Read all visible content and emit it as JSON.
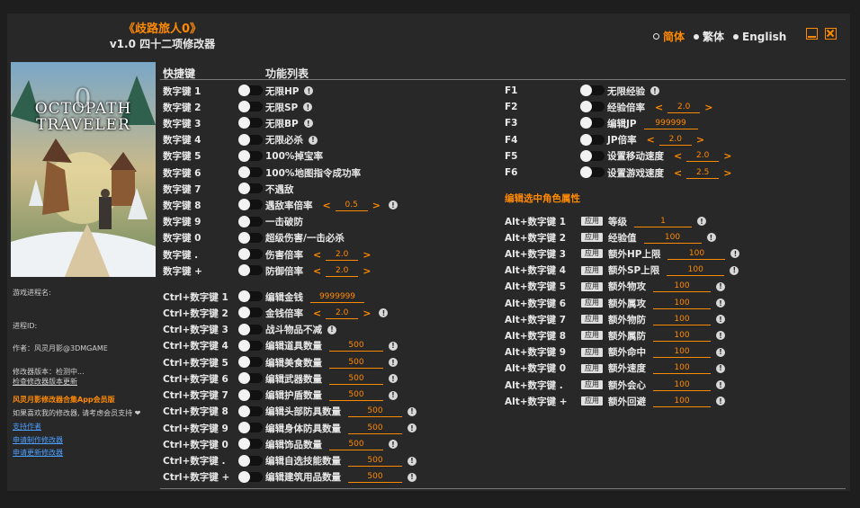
{
  "header": {
    "title": "《歧路旅人0》",
    "subtitle": "v1.0 四十二项修改器"
  },
  "languages": [
    {
      "label": "简体",
      "active": true
    },
    {
      "label": "繁体",
      "active": false
    },
    {
      "label": "English",
      "active": false
    }
  ],
  "cover": {
    "line1": "OCTOPATH",
    "line2": "TRAVELER",
    "logo_mark": "0"
  },
  "sidebar": {
    "process_label": "游戏进程名:",
    "pid_label": "进程ID:",
    "author": "作者：风灵月影@3DMGAME",
    "version_status": "修改器版本：检测中...",
    "check_update": "检查修改器版本更新",
    "promo": "风灵月影修改器合集App会员版",
    "support_note": "如果喜欢我的修改器, 请考虑会员支持 ❤",
    "links": [
      "支持作者",
      "申请制作修改器",
      "申请更新修改器"
    ]
  },
  "columns": {
    "hotkey": "快捷键",
    "function_list": "功能列表"
  },
  "apply_label": "应用",
  "left_rows": [
    {
      "key": "数字键 1",
      "label": "无限HP",
      "info": true
    },
    {
      "key": "数字键 2",
      "label": "无限SP",
      "info": true
    },
    {
      "key": "数字键 3",
      "label": "无限BP",
      "info": true
    },
    {
      "key": "数字键 4",
      "label": "无限必杀",
      "info": true
    },
    {
      "key": "数字键 5",
      "label": "100%掉宝率"
    },
    {
      "key": "数字键 6",
      "label": "100%地图指令成功率"
    },
    {
      "key": "数字键 7",
      "label": "不遇敌"
    },
    {
      "key": "数字键 8",
      "label": "遇敌率倍率",
      "value": "0.5",
      "stepper": true,
      "info": true
    },
    {
      "key": "数字键 9",
      "label": "一击破防"
    },
    {
      "key": "数字键 0",
      "label": "超级伤害/一击必杀"
    },
    {
      "key": "数字键 .",
      "label": "伤害倍率",
      "value": "2.0",
      "stepper": true
    },
    {
      "key": "数字键 +",
      "label": "防御倍率",
      "value": "2.0",
      "stepper": true
    },
    {
      "key": "Ctrl+数字键 1",
      "label": "编辑金钱",
      "value": "9999999"
    },
    {
      "key": "Ctrl+数字键 2",
      "label": "金钱倍率",
      "value": "2.0",
      "stepper": true,
      "info": true
    },
    {
      "key": "Ctrl+数字键 3",
      "label": "战斗物品不减",
      "info": true
    },
    {
      "key": "Ctrl+数字键 4",
      "label": "编辑道具数量",
      "value": "500",
      "info": true
    },
    {
      "key": "Ctrl+数字键 5",
      "label": "编辑美食数量",
      "value": "500",
      "info": true
    },
    {
      "key": "Ctrl+数字键 6",
      "label": "编辑武器数量",
      "value": "500",
      "info": true
    },
    {
      "key": "Ctrl+数字键 7",
      "label": "编辑护盾数量",
      "value": "500",
      "info": true
    },
    {
      "key": "Ctrl+数字键 8",
      "label": "编辑头部防具数量",
      "value": "500",
      "info": true
    },
    {
      "key": "Ctrl+数字键 9",
      "label": "编辑身体防具数量",
      "value": "500",
      "info": true
    },
    {
      "key": "Ctrl+数字键 0",
      "label": "编辑饰品数量",
      "value": "500",
      "info": true
    },
    {
      "key": "Ctrl+数字键 .",
      "label": "编辑自选技能数量",
      "value": "500",
      "info": true
    },
    {
      "key": "Ctrl+数字键 +",
      "label": "编辑建筑用品数量",
      "value": "500",
      "info": true
    }
  ],
  "right_rows": [
    {
      "key": "F1",
      "label": "无限经验",
      "info": true
    },
    {
      "key": "F2",
      "label": "经验倍率",
      "value": "2.0",
      "stepper": true
    },
    {
      "key": "F3",
      "label": "编辑JP",
      "value": "999999"
    },
    {
      "key": "F4",
      "label": "JP倍率",
      "value": "2.0",
      "stepper": true
    },
    {
      "key": "F5",
      "label": "设置移动速度",
      "value": "2.0",
      "stepper": true
    },
    {
      "key": "F6",
      "label": "设置游戏速度",
      "value": "2.5",
      "stepper": true
    }
  ],
  "attr_section_title": "编辑选中角色属性",
  "attr_rows": [
    {
      "key": "Alt+数字键 1",
      "label": "等级",
      "value": "1",
      "info": true
    },
    {
      "key": "Alt+数字键 2",
      "label": "经验值",
      "value": "100",
      "info": true
    },
    {
      "key": "Alt+数字键 3",
      "label": "额外HP上限",
      "value": "100",
      "info": true
    },
    {
      "key": "Alt+数字键 4",
      "label": "额外SP上限",
      "value": "100",
      "info": true
    },
    {
      "key": "Alt+数字键 5",
      "label": "额外物攻",
      "value": "100",
      "info": true
    },
    {
      "key": "Alt+数字键 6",
      "label": "额外属攻",
      "value": "100",
      "info": true
    },
    {
      "key": "Alt+数字键 7",
      "label": "额外物防",
      "value": "100",
      "info": true
    },
    {
      "key": "Alt+数字键 8",
      "label": "额外属防",
      "value": "100",
      "info": true
    },
    {
      "key": "Alt+数字键 9",
      "label": "额外命中",
      "value": "100",
      "info": true
    },
    {
      "key": "Alt+数字键 0",
      "label": "额外速度",
      "value": "100",
      "info": true
    },
    {
      "key": "Alt+数字键 .",
      "label": "额外会心",
      "value": "100",
      "info": true
    },
    {
      "key": "Alt+数字键 +",
      "label": "额外回避",
      "value": "100",
      "info": true
    }
  ],
  "colors": {
    "accent": "#ff8a00",
    "link": "#4a9fff",
    "background": "#282828"
  },
  "icons": {
    "info": "info-icon",
    "minimize": "minimize-icon",
    "close": "close-icon"
  }
}
